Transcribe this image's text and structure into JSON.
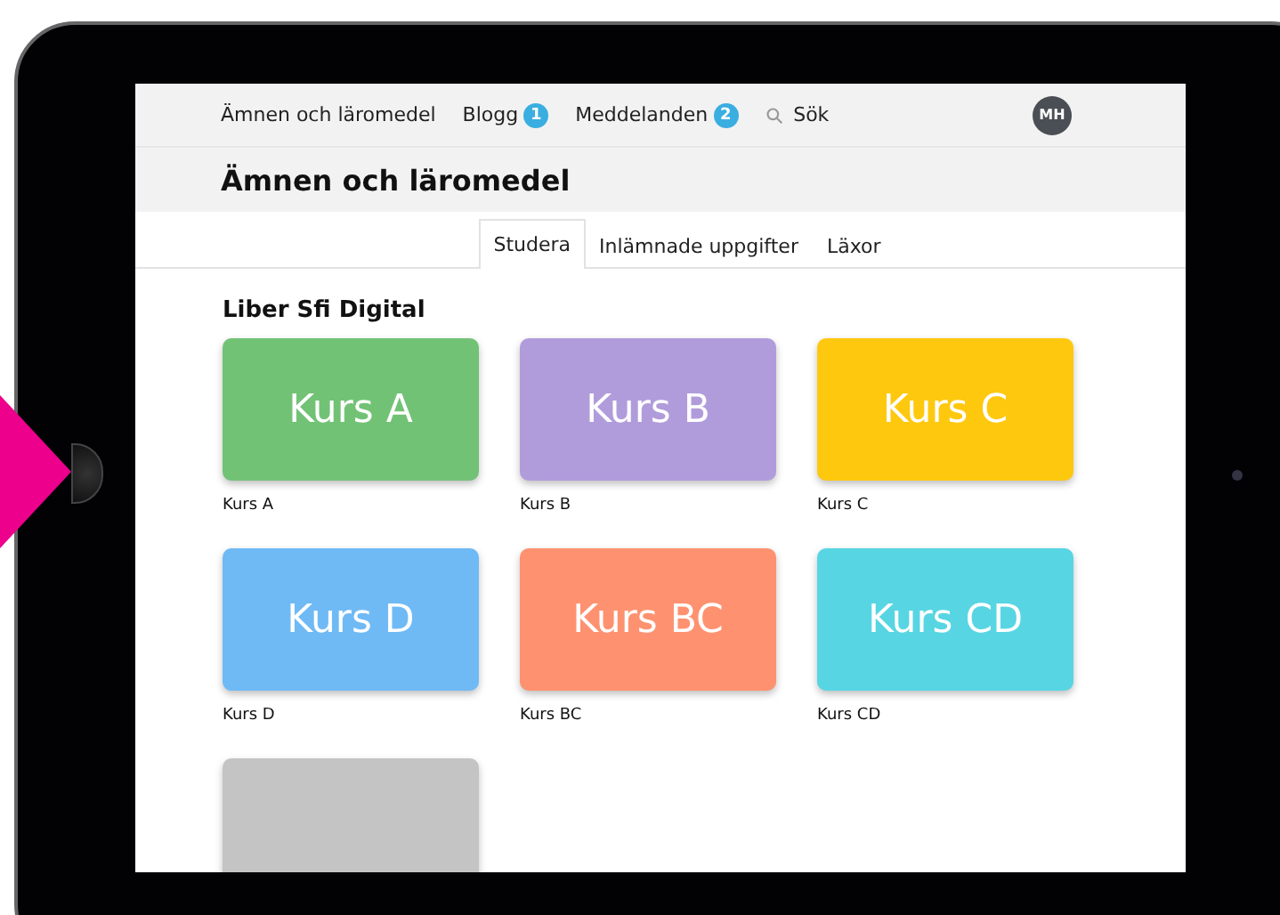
{
  "nav": {
    "items": [
      {
        "label": "Ämnen och läromedel"
      },
      {
        "label": "Blogg",
        "badge": "1"
      },
      {
        "label": "Meddelanden",
        "badge": "2"
      }
    ],
    "search": "Sök",
    "avatar": "MH"
  },
  "page_title": "Ämnen och läromedel",
  "tabs": [
    {
      "label": "Studera",
      "selected": true
    },
    {
      "label": "Inlämnade uppgifter",
      "selected": false
    },
    {
      "label": "Läxor",
      "selected": false
    }
  ],
  "section_title": "Liber Sfi Digital",
  "courses": [
    {
      "title": "Kurs A",
      "label": "Kurs A",
      "color": "#72c276"
    },
    {
      "title": "Kurs B",
      "label": "Kurs B",
      "color": "#b19cdb"
    },
    {
      "title": "Kurs C",
      "label": "Kurs C",
      "color": "#fec80f"
    },
    {
      "title": "Kurs D",
      "label": "Kurs D",
      "color": "#6fbaf5"
    },
    {
      "title": "Kurs BC",
      "label": "Kurs BC",
      "color": "#fe9270"
    },
    {
      "title": "Kurs CD",
      "label": "Kurs CD",
      "color": "#58d5e3"
    },
    {
      "color": "#c4c4c4"
    }
  ]
}
